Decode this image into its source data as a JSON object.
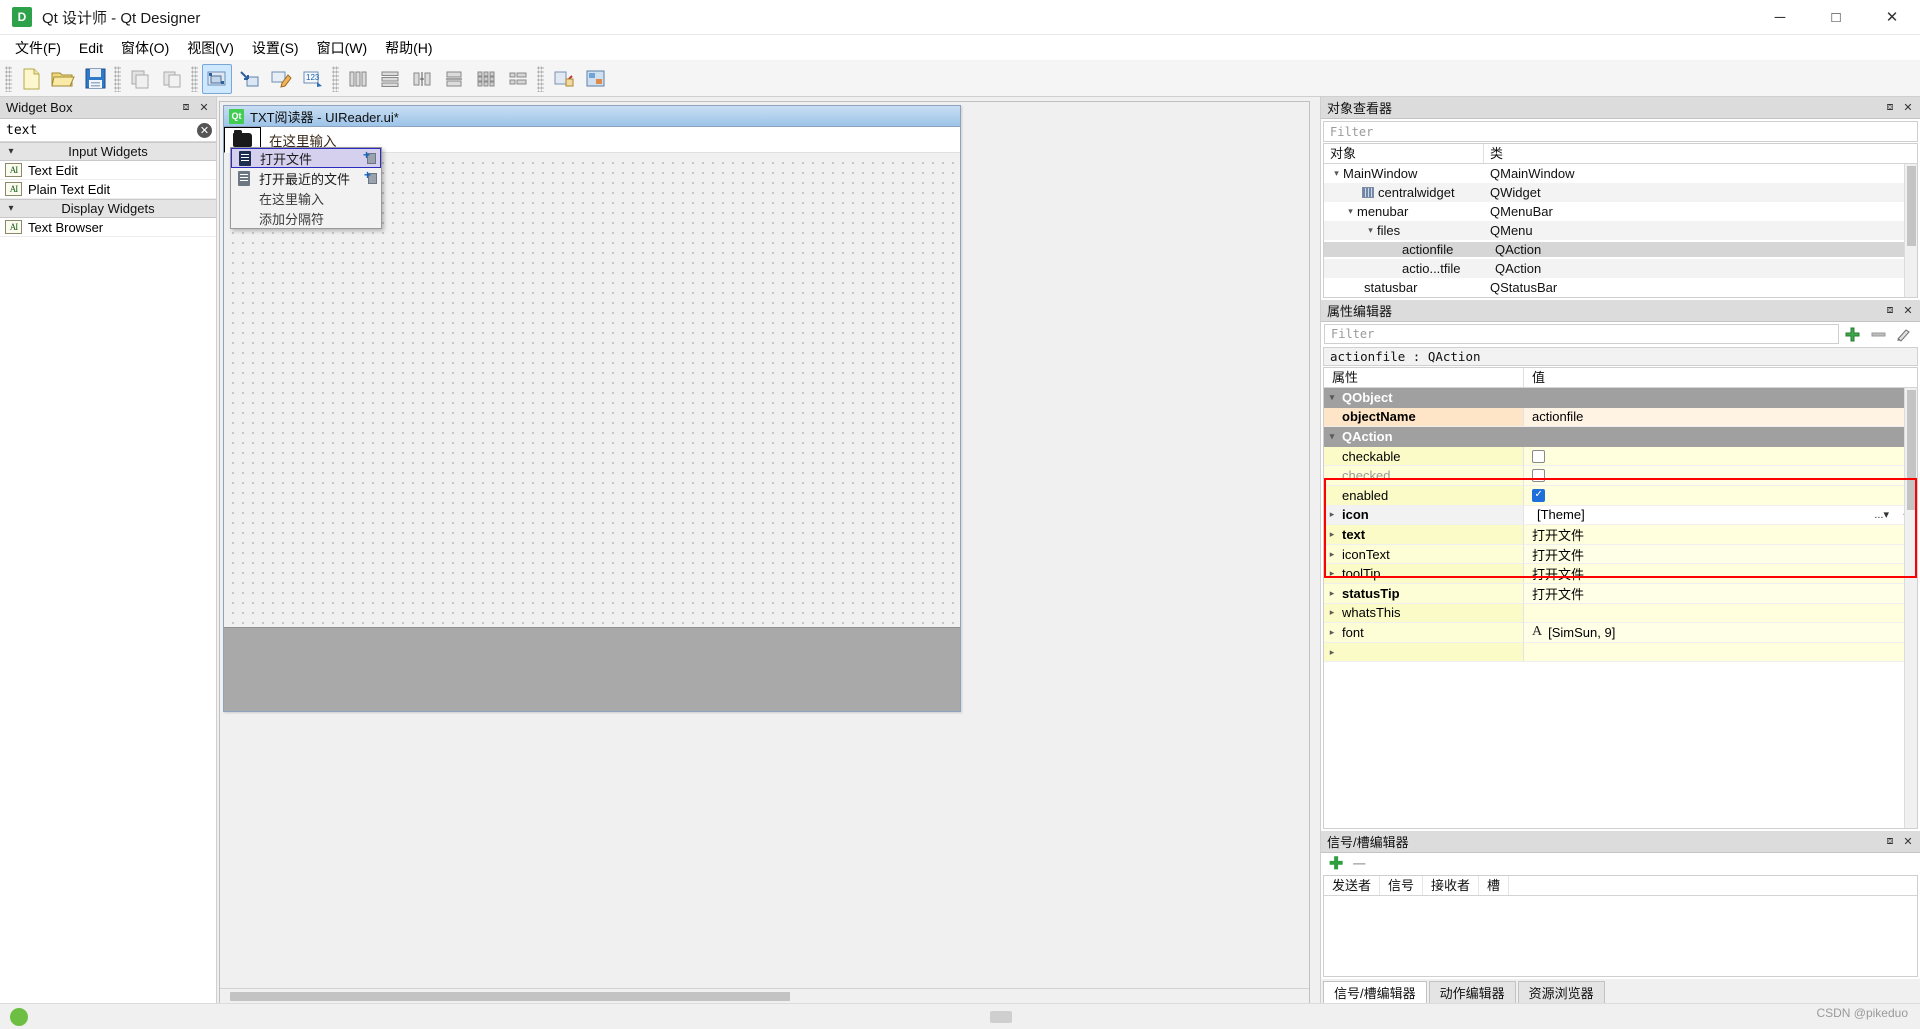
{
  "window": {
    "title": "Qt 设计师 - Qt Designer",
    "app_badge": "D",
    "minimize": "─",
    "maximize": "□",
    "close": "✕"
  },
  "menubar": {
    "items": [
      {
        "label": "文件(F)"
      },
      {
        "label": "Edit"
      },
      {
        "label": "窗体(O)"
      },
      {
        "label": "视图(V)"
      },
      {
        "label": "设置(S)"
      },
      {
        "label": "窗口(W)"
      },
      {
        "label": "帮助(H)"
      }
    ]
  },
  "toolbar": {
    "buttons": [
      {
        "name": "new-form-icon"
      },
      {
        "name": "open-form-icon"
      },
      {
        "name": "save-form-icon"
      },
      {
        "name": "cut-icon"
      },
      {
        "name": "copy-icon"
      },
      {
        "name": "edit-widgets-icon"
      },
      {
        "name": "edit-signals-slots-icon"
      },
      {
        "name": "edit-buddies-icon"
      },
      {
        "name": "edit-tab-order-icon"
      },
      {
        "name": "layout-horizontally-icon"
      },
      {
        "name": "layout-vertically-icon"
      },
      {
        "name": "layout-splitter-horizontal-icon"
      },
      {
        "name": "layout-splitter-vertical-icon"
      },
      {
        "name": "layout-grid-icon"
      },
      {
        "name": "layout-form-icon"
      },
      {
        "name": "break-layout-icon"
      },
      {
        "name": "adjust-size-icon"
      }
    ]
  },
  "widget_box": {
    "title": "Widget Box",
    "filter_value": "text",
    "groups": [
      {
        "label": "Input Widgets",
        "items": [
          {
            "label": "Text Edit",
            "icon": "text-edit-icon"
          },
          {
            "label": "Plain Text Edit",
            "icon": "plain-text-edit-icon"
          }
        ]
      },
      {
        "label": "Display Widgets",
        "items": [
          {
            "label": "Text Browser",
            "icon": "text-browser-icon"
          }
        ]
      }
    ]
  },
  "form_window": {
    "title": "TXT阅读器 - UIReader.ui*",
    "badge": "Qt",
    "menubar_items": [
      {
        "label": "",
        "icon": "folder-icon",
        "selected": true
      },
      {
        "label": "在这里输入",
        "icon": "",
        "selected": false
      }
    ],
    "context_menu": [
      {
        "label": "打开文件",
        "icon": "document-icon",
        "selected": true,
        "has_badge": true
      },
      {
        "label": "打开最近的文件",
        "icon": "document-icon",
        "selected": false,
        "has_badge": true
      },
      {
        "label": "在这里输入",
        "icon": "",
        "selected": false,
        "has_badge": false
      },
      {
        "label": "添加分隔符",
        "icon": "",
        "selected": false,
        "has_badge": false
      }
    ]
  },
  "object_inspector": {
    "title": "对象查看器",
    "filter_placeholder": "Filter",
    "columns": [
      "对象",
      "类"
    ],
    "rows": [
      {
        "name": "MainWindow",
        "cls": "QMainWindow",
        "indent": 0,
        "chevron": "⌄",
        "icon": "",
        "selected": false
      },
      {
        "name": "centralwidget",
        "cls": "QWidget",
        "indent": 1,
        "chevron": "",
        "icon": "grid-icon",
        "selected": false
      },
      {
        "name": "menubar",
        "cls": "QMenuBar",
        "indent": 1,
        "chevron": "⌄",
        "icon": "",
        "selected": false
      },
      {
        "name": "files",
        "cls": "QMenu",
        "indent": 2,
        "chevron": "⌄",
        "icon": "",
        "selected": false
      },
      {
        "name": "actionfile",
        "cls": "QAction",
        "indent": 3,
        "chevron": "",
        "icon": "action-icon-dark",
        "selected": true
      },
      {
        "name": "actio...tfile",
        "cls": "QAction",
        "indent": 3,
        "chevron": "",
        "icon": "action-icon",
        "selected": false
      },
      {
        "name": "statusbar",
        "cls": "QStatusBar",
        "indent": 1,
        "chevron": "",
        "icon": "",
        "selected": false
      }
    ]
  },
  "property_editor": {
    "title": "属性编辑器",
    "filter_placeholder": "Filter",
    "object_line": "actionfile : QAction",
    "columns": [
      "属性",
      "值"
    ],
    "toolbar_icons": [
      "add-icon",
      "remove-icon",
      "configure-icon"
    ],
    "rows": [
      {
        "name": "QObject",
        "value": "",
        "type": "group"
      },
      {
        "name": "objectName",
        "value": "actionfile",
        "type": "orange",
        "bold": true,
        "expander": false
      },
      {
        "name": "QAction",
        "value": "",
        "type": "group"
      },
      {
        "name": "checkable",
        "value": "",
        "type": "yellow",
        "widget": "checkbox",
        "checked": false,
        "expander": false
      },
      {
        "name": "checked",
        "value": "",
        "type": "yellow2",
        "widget": "checkbox",
        "checked": false,
        "dim": true,
        "expander": false
      },
      {
        "name": "enabled",
        "value": "",
        "type": "yellow",
        "widget": "checkbox",
        "checked": true,
        "expander": false
      },
      {
        "name": "icon",
        "value": "[Theme]",
        "type": "white",
        "bold": true,
        "expander": true,
        "highlighted": true
      },
      {
        "name": "text",
        "value": "打开文件",
        "type": "yellow",
        "bold": true,
        "expander": true,
        "highlighted": true
      },
      {
        "name": "iconText",
        "value": "打开文件",
        "type": "yellow2",
        "expander": true,
        "highlighted": true
      },
      {
        "name": "toolTip",
        "value": "打开文件",
        "type": "yellow",
        "expander": true,
        "highlighted": true
      },
      {
        "name": "statusTip",
        "value": "打开文件",
        "type": "yellow2",
        "bold": true,
        "expander": true,
        "highlighted": true
      },
      {
        "name": "whatsThis",
        "value": "",
        "type": "yellow",
        "expander": true
      },
      {
        "name": "font",
        "value": "[SimSun, 9]",
        "type": "yellow2",
        "expander": true,
        "prefix": "A"
      }
    ],
    "highlight_color": "#ff0000"
  },
  "signal_slot_editor": {
    "title": "信号/槽编辑器",
    "columns": [
      "发送者",
      "信号",
      "接收者",
      "槽"
    ]
  },
  "bottom_tabs": [
    {
      "label": "信号/槽编辑器",
      "active": true
    },
    {
      "label": "动作编辑器",
      "active": false
    },
    {
      "label": "资源浏览器",
      "active": false
    }
  ],
  "watermark": "CSDN @pikeduo"
}
